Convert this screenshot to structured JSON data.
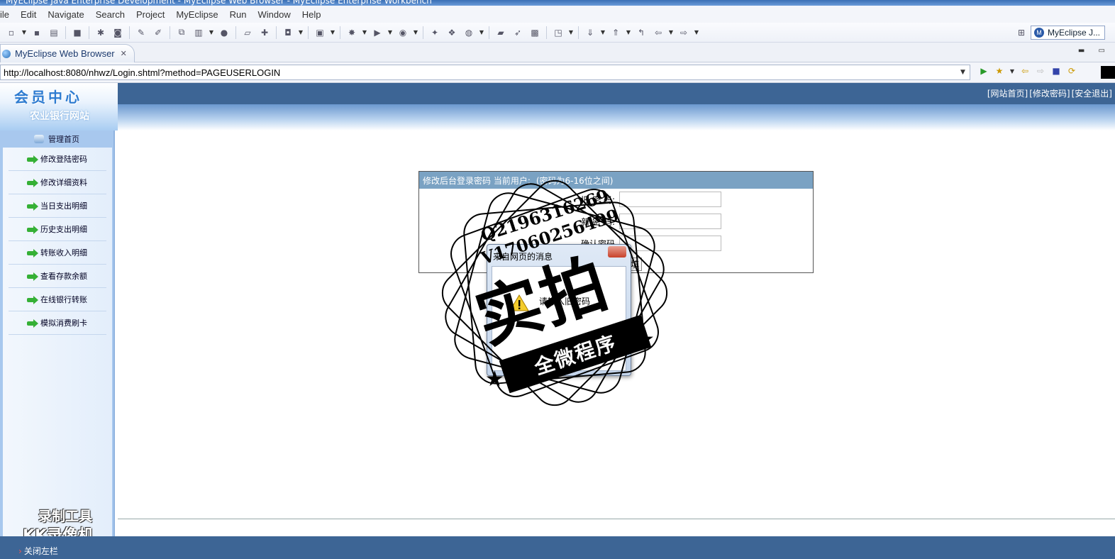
{
  "window": {
    "title": "MyEclipse Java Enterprise Development - MyEclipse Web Browser - MyEclipse Enterprise Workbench"
  },
  "menu": [
    "ile",
    "Edit",
    "Navigate",
    "Search",
    "Project",
    "MyEclipse",
    "Run",
    "Window",
    "Help"
  ],
  "perspective": {
    "label": "MyEclipse J..."
  },
  "editor_tab": {
    "label": "MyEclipse Web Browser"
  },
  "browser": {
    "url": "http://localhost:8080/nhwz/Login.shtml?method=PAGEUSERLOGIN"
  },
  "site": {
    "brand": "会员中心",
    "bank_name": "农业银行网站",
    "top_links": [
      "[网站首页]",
      "[修改密码]",
      "[安全退出]"
    ],
    "sidebar_head": "管理首页",
    "sidebar_items": [
      "修改登陆密码",
      "修改详细资料",
      "当日支出明细",
      "历史支出明细",
      "转账收入明细",
      "查看存款余额",
      "在线银行转账",
      "模拟消费刷卡"
    ],
    "close_left": "关闭左栏"
  },
  "password_form": {
    "header_prefix": "修改后台登录密码 当前用户:",
    "header_user": "",
    "header_suffix": "(密码为6-16位之间)",
    "old_label": "旧 密 码:",
    "new_label": "新 密 码:",
    "confirm_label": "确认密码",
    "refill_label": "填"
  },
  "alert_dialog": {
    "title": "来自网页的消息",
    "message": "请输入旧密码"
  },
  "overlays": {
    "stamp_big": "实拍",
    "stamp_ribbon": "全微程序",
    "stamp_q1": "Q2196316269",
    "stamp_q2": "V17060256499",
    "kk_line1": "录制工具",
    "kk_line2": "KK录像机"
  }
}
